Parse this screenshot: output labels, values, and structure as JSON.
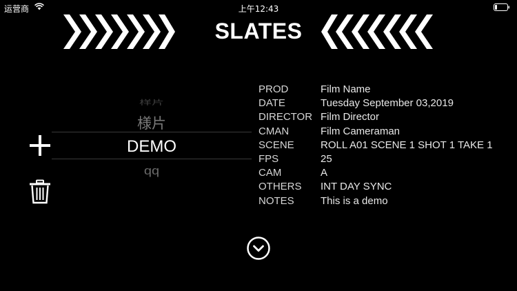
{
  "status_bar": {
    "carrier": "运营商",
    "time": "上午12:43"
  },
  "header": {
    "title": "SLATES"
  },
  "picker": {
    "items": [
      "样片",
      "様片",
      "DEMO",
      "qq"
    ],
    "selected_index": 2
  },
  "info": [
    {
      "key": "PROD",
      "value": "Film Name"
    },
    {
      "key": "DATE",
      "value": "Tuesday September 03,2019"
    },
    {
      "key": "DIRECTOR",
      "value": "Film Director"
    },
    {
      "key": "CMAN",
      "value": "Film Cameraman"
    },
    {
      "key": "SCENE",
      "value": "ROLL A01 SCENE 1 SHOT 1 TAKE 1"
    },
    {
      "key": "FPS",
      "value": "25"
    },
    {
      "key": "CAM",
      "value": "A"
    },
    {
      "key": "OTHERS",
      "value": "INT DAY SYNC"
    },
    {
      "key": "NOTES",
      "value": "This is a demo"
    }
  ],
  "icons": {
    "wifi": "wifi-icon",
    "battery": "battery-icon",
    "left_chevrons": "chevrons-right-icon",
    "right_chevrons": "chevrons-left-icon",
    "add": "plus-icon",
    "delete": "trash-icon",
    "expand": "chevron-down-circle-icon"
  }
}
